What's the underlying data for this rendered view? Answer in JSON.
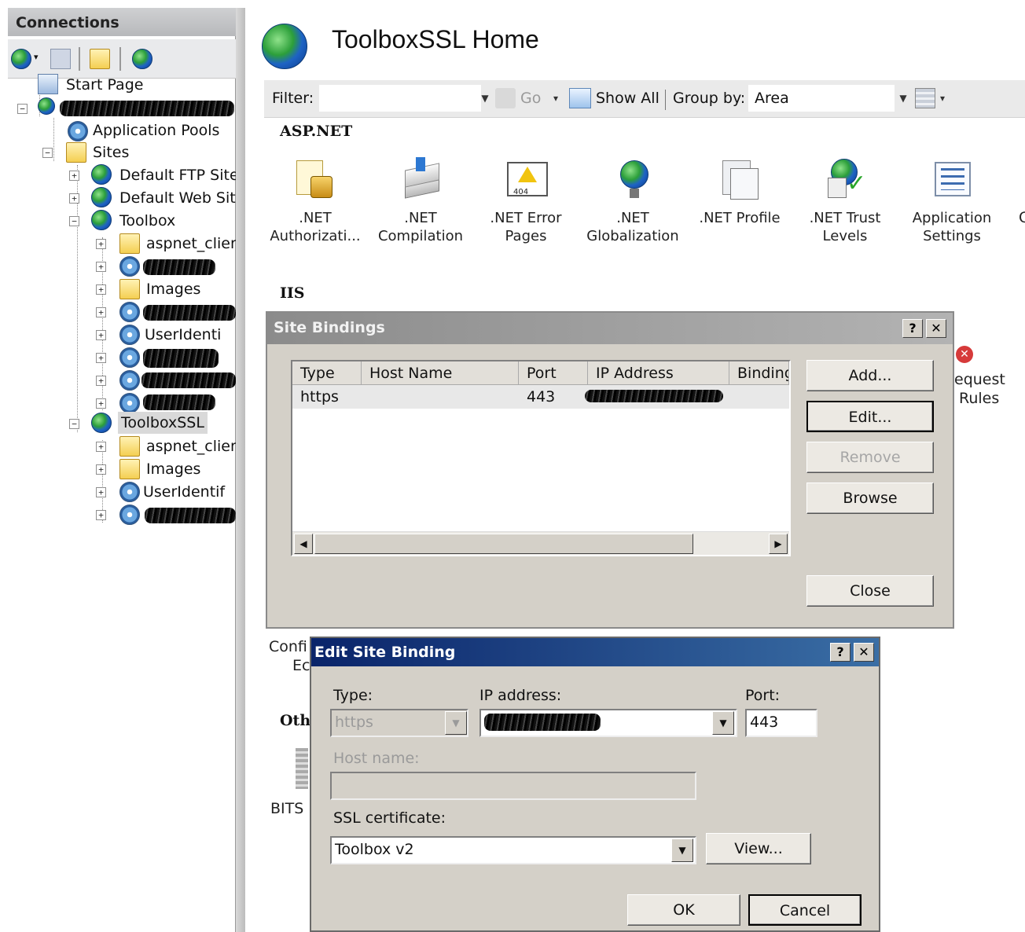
{
  "connections": {
    "title": "Connections",
    "tree": {
      "start_page": "Start Page",
      "app_pools": "Application Pools",
      "sites": "Sites",
      "default_ftp": "Default FTP Site",
      "default_web": "Default Web Site",
      "toolbox": "Toolbox",
      "toolbox_children": [
        "aspnet_client",
        "Images",
        "UserIdenti"
      ],
      "toolboxssl": "ToolboxSSL",
      "toolboxssl_children": [
        "aspnet_client",
        "Images",
        "UserIdentif"
      ]
    }
  },
  "home": {
    "title": "ToolboxSSL Home"
  },
  "filterbar": {
    "filter_label": "Filter:",
    "go_label": "Go",
    "show_all_label": "Show All",
    "group_by_label": "Group by:",
    "group_by_value": "Area"
  },
  "sections": {
    "aspnet": "ASP.NET",
    "iis": "IIS",
    "other": "Oth"
  },
  "features": [
    {
      "line1": ".NET",
      "line2": "Authorizati..."
    },
    {
      "line1": ".NET",
      "line2": "Compilation"
    },
    {
      "line1": ".NET Error",
      "line2": "Pages"
    },
    {
      "line1": ".NET",
      "line2": "Globalization"
    },
    {
      "line1": ".NET Profile",
      "line2": ""
    },
    {
      "line1": ".NET Trust",
      "line2": "Levels"
    },
    {
      "line1": "Application",
      "line2": "Settings"
    }
  ],
  "partial_labels": {
    "request": "equest",
    "rules": "Rules",
    "config": "Confi",
    "ec": "Ec",
    "bits": "BITS"
  },
  "site_bindings": {
    "title": "Site Bindings",
    "help": "?",
    "close_x": "✕",
    "columns": [
      "Type",
      "Host Name",
      "Port",
      "IP Address",
      "Binding"
    ],
    "rows": [
      {
        "type": "https",
        "host": "",
        "port": "443"
      }
    ],
    "buttons": {
      "add": "Add...",
      "edit": "Edit...",
      "remove": "Remove",
      "browse": "Browse",
      "close": "Close"
    }
  },
  "edit_binding": {
    "title": "Edit Site Binding",
    "help": "?",
    "close_x": "✕",
    "type_label": "Type:",
    "type_value": "https",
    "ip_label": "IP address:",
    "port_label": "Port:",
    "port_value": "443",
    "host_label": "Host name:",
    "host_value": "",
    "ssl_label": "SSL certificate:",
    "ssl_value": "Toolbox v2",
    "view_button": "View...",
    "ok_button": "OK",
    "cancel_button": "Cancel"
  },
  "colors": {
    "active_title": "#0a246a",
    "inactive_title": "#8b8b8b",
    "dialog_face": "#d4d0c8"
  }
}
